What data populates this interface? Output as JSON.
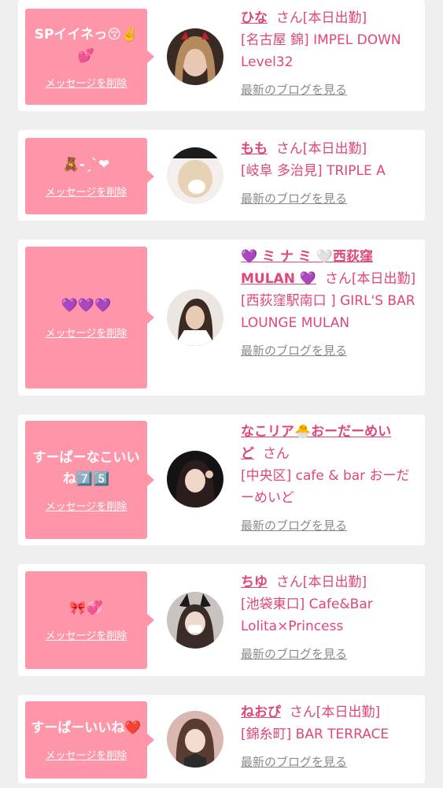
{
  "cards": [
    {
      "message": "SPイイネっ😚✌️💕",
      "delete_label": "メッセージを削除",
      "name": "ひな",
      "suffix": "さん[本日出勤]",
      "shop": "[名古屋 錦] IMPEL DOWN Level32",
      "blog_label": "最新のブログを見る"
    },
    {
      "message": "🧸-ˏˋ❤",
      "delete_label": "メッセージを削除",
      "name": "もも",
      "suffix": "さん[本日出勤]",
      "shop": "[岐阜 多治見] TRIPLE A",
      "blog_label": "最新のブログを見る"
    },
    {
      "message": "💜💜💜",
      "delete_label": "メッセージを削除",
      "name": "💜 ミ ナ ミ 🤍西荻窪 MULAN 💜",
      "suffix": "さん[本日出勤]",
      "shop": "[西荻窪駅南口 ] GIRL'S BAR LOUNGE MULAN",
      "blog_label": "最新のブログを見る"
    },
    {
      "message": "すーぱーなこいいね7️⃣5️⃣",
      "delete_label": "メッセージを削除",
      "name": "なこリア🐣おーだーめいど",
      "suffix": "さん",
      "shop": "[中央区] cafe & bar おーだーめいど",
      "blog_label": "最新のブログを見る"
    },
    {
      "message": "🎀💞",
      "delete_label": "メッセージを削除",
      "name": "ちゆ",
      "suffix": "さん[本日出勤]",
      "shop": "[池袋東口] Cafe&Bar Lolita×Princess",
      "blog_label": "最新のブログを見る"
    },
    {
      "message": "すーぱーいいね❤️",
      "delete_label": "メッセージを削除",
      "name": "ねおぴ",
      "suffix": "さん[本日出勤]",
      "shop": "[錦糸町] BAR TERRACE",
      "blog_label": "最新のブログを見る"
    }
  ],
  "colors": {
    "bubble": "#ff95a8",
    "name": "#e0457b",
    "link_gray": "#8a8a8a",
    "background": "#efefef"
  }
}
